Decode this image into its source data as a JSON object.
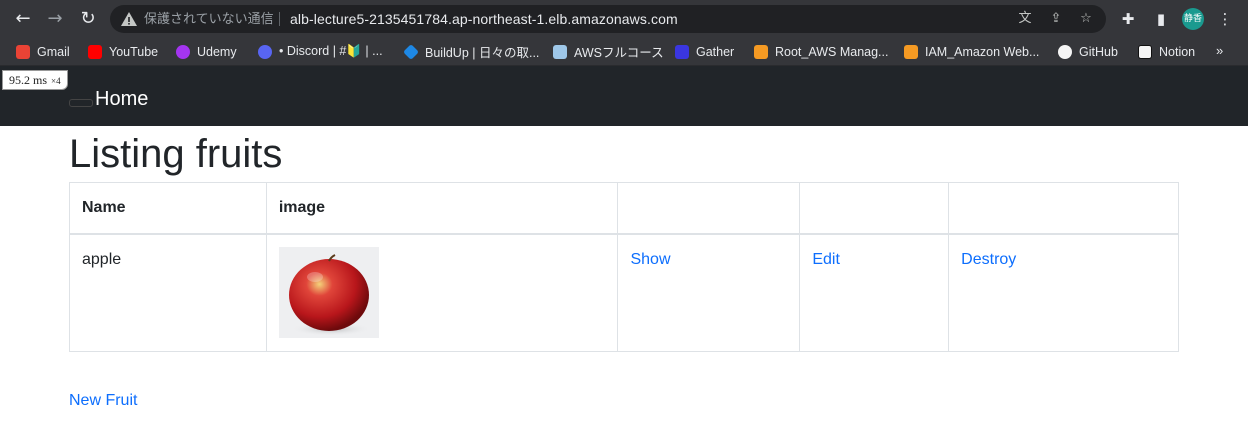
{
  "browser": {
    "security_label": "保護されていない通信",
    "url": "alb-lecture5-2135451784.ap-northeast-1.elb.amazonaws.com",
    "avatar_label": "静香",
    "bookmarks": [
      {
        "label": "Gmail",
        "color": "#ea4335"
      },
      {
        "label": "YouTube",
        "color": "#ff0000"
      },
      {
        "label": "Udemy",
        "color": "#a435f0"
      },
      {
        "label": "• Discord | #🔰 | ...",
        "color": "#5865f2"
      },
      {
        "label": "BuildUp | 日々の取...",
        "color": "#1e88e5"
      },
      {
        "label": "AWSフルコース",
        "color": "#f5f5f5"
      },
      {
        "label": "Gather",
        "color": "#3a36e0"
      },
      {
        "label": "Root_AWS Manag...",
        "color": "#f59a23"
      },
      {
        "label": "IAM_Amazon Web...",
        "color": "#f59a23"
      },
      {
        "label": "GitHub",
        "color": "#f5f5f5"
      },
      {
        "label": "Notion",
        "color": "#f5f5f5"
      }
    ],
    "more_label": "»"
  },
  "perf": {
    "value": "95.2 ms",
    "multiplier": "×4"
  },
  "navbar": {
    "home_label": "Home"
  },
  "page": {
    "title": "Listing fruits"
  },
  "table": {
    "headers": [
      "Name",
      "image",
      "",
      "",
      ""
    ],
    "rows": [
      {
        "name": "apple",
        "show": "Show",
        "edit": "Edit",
        "destroy": "Destroy"
      }
    ]
  },
  "new_link": "New Fruit",
  "colors": {
    "link": "#0d6efd",
    "navbar": "#212529",
    "chrome": "#35363a"
  }
}
